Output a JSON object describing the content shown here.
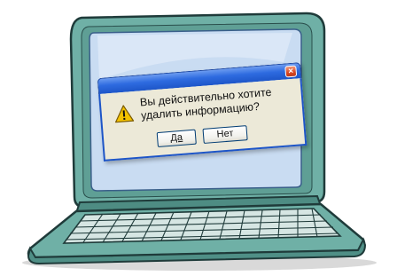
{
  "dialog": {
    "message_line1": "Вы действительно хотите",
    "message_line2": "удалить информацию?",
    "yes_label": "Да",
    "no_label": "Нет",
    "close_glyph": "×"
  },
  "colors": {
    "laptop_body": "#6fb0a6",
    "laptop_outline": "#1f3b3a",
    "screen": "#c9dcf2",
    "titlebar": "#2e6be0",
    "dialog_body": "#ece9d8",
    "close_button": "#d94722",
    "warning_icon": "#f3c200"
  },
  "icons": {
    "dialog_icon": "warning-icon",
    "close_icon": "close-icon"
  }
}
